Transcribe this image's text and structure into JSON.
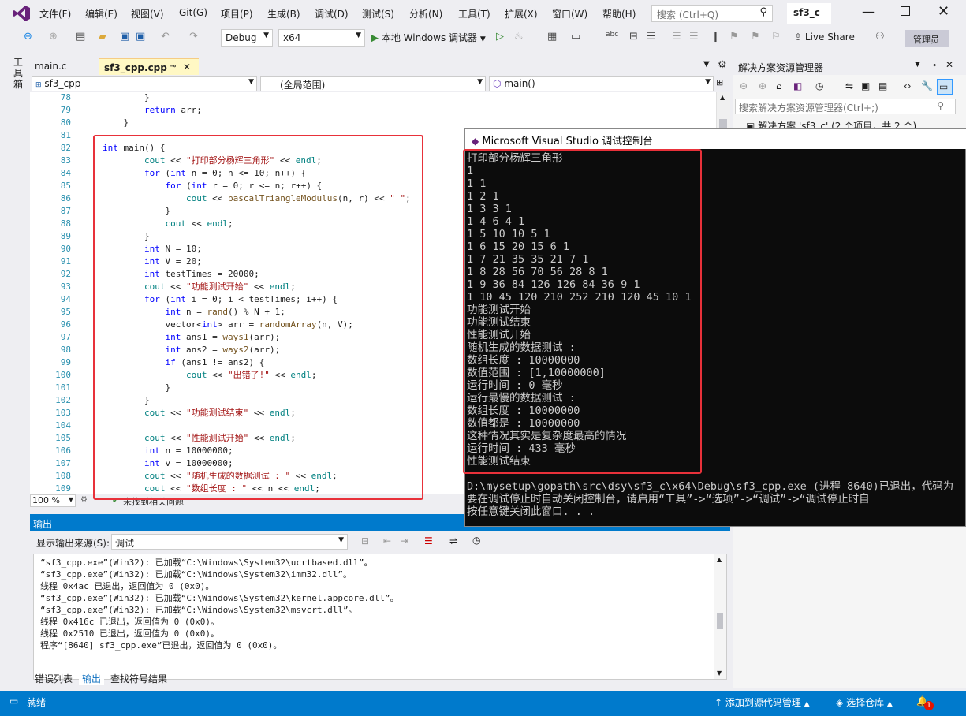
{
  "menu": {
    "items": [
      "文件(F)",
      "编辑(E)",
      "视图(V)",
      "Git(G)",
      "项目(P)",
      "生成(B)",
      "调试(D)",
      "测试(S)",
      "分析(N)",
      "工具(T)",
      "扩展(X)",
      "窗口(W)",
      "帮助(H)"
    ],
    "search_placeholder": "搜索 (Ctrl+Q)",
    "solution_name": "sf3_c"
  },
  "toolbar": {
    "config": "Debug",
    "platform": "x64",
    "run_label": "本地 Windows 调试器",
    "live_share": "Live Share",
    "admin": "管理员"
  },
  "left_strip": {
    "label": "工具箱"
  },
  "editor": {
    "tabs": [
      {
        "label": "main.c"
      },
      {
        "label": "sf3_cpp.cpp",
        "pin": "⊕"
      }
    ],
    "nav": {
      "project": "sf3_cpp",
      "scope": "(全局范围)",
      "member": "main()"
    },
    "zoom": "100 %",
    "status": "未找到相关问题",
    "lines": [
      {
        "n": "78",
        "code": "        }"
      },
      {
        "n": "79",
        "code": "        return arr;"
      },
      {
        "n": "80",
        "code": "    }"
      },
      {
        "n": "81",
        "code": ""
      },
      {
        "n": "82",
        "code": "int main() {"
      },
      {
        "n": "83",
        "code": "        cout << \"打印部分杨辉三角形\" << endl;"
      },
      {
        "n": "84",
        "code": "        for (int n = 0; n <= 10; n++) {"
      },
      {
        "n": "85",
        "code": "            for (int r = 0; r <= n; r++) {"
      },
      {
        "n": "86",
        "code": "                cout << pascalTriangleModulus(n, r) << \" \";"
      },
      {
        "n": "87",
        "code": "            }"
      },
      {
        "n": "88",
        "code": "            cout << endl;"
      },
      {
        "n": "89",
        "code": "        }"
      },
      {
        "n": "90",
        "code": "        int N = 10;"
      },
      {
        "n": "91",
        "code": "        int V = 20;"
      },
      {
        "n": "92",
        "code": "        int testTimes = 20000;"
      },
      {
        "n": "93",
        "code": "        cout << \"功能测试开始\" << endl;"
      },
      {
        "n": "94",
        "code": "        for (int i = 0; i < testTimes; i++) {"
      },
      {
        "n": "95",
        "code": "            int n = rand() % N + 1;"
      },
      {
        "n": "96",
        "code": "            vector<int> arr = randomArray(n, V);"
      },
      {
        "n": "97",
        "code": "            int ans1 = ways1(arr);"
      },
      {
        "n": "98",
        "code": "            int ans2 = ways2(arr);"
      },
      {
        "n": "99",
        "code": "            if (ans1 != ans2) {"
      },
      {
        "n": "100",
        "code": "                cout << \"出错了!\" << endl;"
      },
      {
        "n": "101",
        "code": "            }"
      },
      {
        "n": "102",
        "code": "        }"
      },
      {
        "n": "103",
        "code": "        cout << \"功能测试结束\" << endl;"
      },
      {
        "n": "104",
        "code": ""
      },
      {
        "n": "105",
        "code": "        cout << \"性能测试开始\" << endl;"
      },
      {
        "n": "106",
        "code": "        int n = 10000000;"
      },
      {
        "n": "107",
        "code": "        int v = 10000000;"
      },
      {
        "n": "108",
        "code": "        cout << \"随机生成的数据测试 : \" << endl;"
      },
      {
        "n": "109",
        "code": "        cout << \"数组长度 : \" << n << endl;"
      }
    ]
  },
  "output": {
    "title": "输出",
    "source_label": "显示输出来源(S):",
    "source_value": "调试",
    "lines": [
      "“sf3_cpp.exe”(Win32): 已加载“C:\\Windows\\System32\\ucrtbased.dll”。",
      "“sf3_cpp.exe”(Win32): 已加载“C:\\Windows\\System32\\imm32.dll”。",
      "线程 0x4ac 已退出，返回值为 0 (0x0)。",
      "“sf3_cpp.exe”(Win32): 已加载“C:\\Windows\\System32\\kernel.appcore.dll”。",
      "“sf3_cpp.exe”(Win32): 已加载“C:\\Windows\\System32\\msvcrt.dll”。",
      "线程 0x416c 已退出，返回值为 0 (0x0)。",
      "线程 0x2510 已退出，返回值为 0 (0x0)。",
      "程序“[8640] sf3_cpp.exe”已退出，返回值为 0 (0x0)。"
    ],
    "tabs": [
      "错误列表",
      "输出",
      "查找符号结果"
    ]
  },
  "solution_explorer": {
    "title": "解决方案资源管理器",
    "search_placeholder": "搜索解决方案资源管理器(Ctrl+;)",
    "item": "解决方案 'sf3_c' (2 个项目，共 2 个)"
  },
  "console": {
    "title": "Microsoft Visual Studio 调试控制台",
    "lines": [
      "打印部分杨辉三角形",
      "1",
      "1 1",
      "1 2 1",
      "1 3 3 1",
      "1 4 6 4 1",
      "1 5 10 10 5 1",
      "1 6 15 20 15 6 1",
      "1 7 21 35 35 21 7 1",
      "1 8 28 56 70 56 28 8 1",
      "1 9 36 84 126 126 84 36 9 1",
      "1 10 45 120 210 252 210 120 45 10 1",
      "功能测试开始",
      "功能测试结束",
      "性能测试开始",
      "随机生成的数据测试 :",
      "数组长度 : 10000000",
      "数值范围 : [1,10000000]",
      "运行时间 : 0 毫秒",
      "运行最慢的数据测试 :",
      "数组长度 : 10000000",
      "数值都是 : 10000000",
      "这种情况其实是复杂度最高的情况",
      "运行时间 : 433 毫秒",
      "性能测试结束",
      "",
      "D:\\mysetup\\gopath\\src\\dsy\\sf3_c\\x64\\Debug\\sf3_cpp.exe (进程 8640)已退出，代码为",
      "要在调试停止时自动关闭控制台，请启用“工具”->“选项”->“调试”->“调试停止时自",
      "按任意键关闭此窗口. . ."
    ]
  },
  "statusbar": {
    "ready": "就绪",
    "add_source": "添加到源代码管理",
    "select_repo": "选择仓库",
    "notif_count": "1"
  },
  "colors": {
    "accent": "#007acc",
    "highlight_box": "#e8313a",
    "console_bg": "#0c0c0c"
  }
}
